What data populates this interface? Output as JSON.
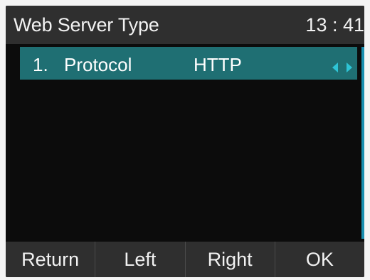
{
  "header": {
    "title": "Web Server Type",
    "time": "13 : 41"
  },
  "list": {
    "items": [
      {
        "index": "1.",
        "label": "Protocol",
        "value": "HTTP",
        "selected": true
      }
    ]
  },
  "softkeys": [
    {
      "label": "Return"
    },
    {
      "label": "Left"
    },
    {
      "label": "Right"
    },
    {
      "label": "OK"
    }
  ],
  "colors": {
    "highlight": "#1f6f73",
    "scrollbar": "#1a8fb0",
    "arrow": "#2ec4d6"
  },
  "icons": {
    "arrows": "left-right-arrows-icon"
  }
}
